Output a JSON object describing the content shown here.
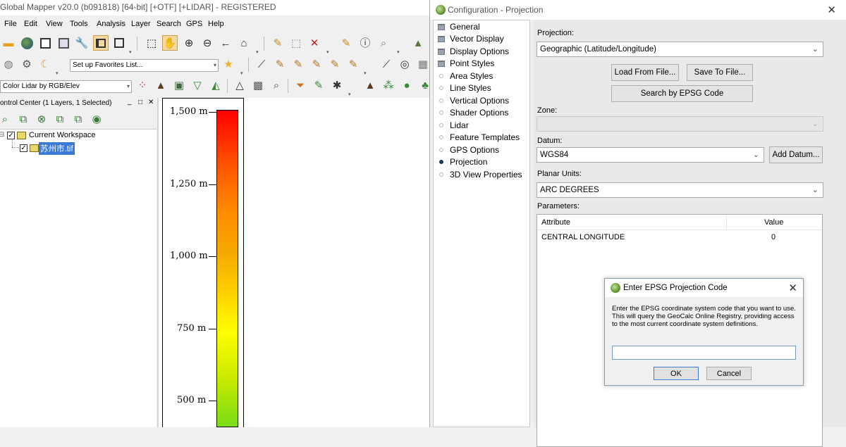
{
  "app": {
    "title": "Global Mapper v20.0 (b091818) [64-bit] [+OTF] [+LIDAR] - REGISTERED",
    "menu": [
      "File",
      "Edit",
      "View",
      "Tools",
      "Analysis",
      "Layer",
      "Search",
      "GPS",
      "Help"
    ],
    "favorites_combo": "Set up Favorites List...",
    "lidar_combo": "Color Lidar by RGB/Elev"
  },
  "control_center": {
    "header": "ontrol Center (1 Layers, 1 Selected)",
    "header_buttons": [
      "_",
      "□",
      "✕"
    ],
    "workspace_label": "Current Workspace",
    "layer_label": "苏州市.tif"
  },
  "legend": {
    "labels": [
      "1,500 m",
      "1,250 m",
      "1,000 m",
      "750 m",
      "500 m"
    ],
    "colors": {
      "top": "#ff0000",
      "mid": "#ffff00",
      "bottom": "#79dc18"
    }
  },
  "config": {
    "title": "Configuration - Projection",
    "nav": [
      {
        "label": "General",
        "kind": "folder"
      },
      {
        "label": "Vector Display",
        "kind": "folder"
      },
      {
        "label": "Display Options",
        "kind": "folder"
      },
      {
        "label": "Point Styles",
        "kind": "folder"
      },
      {
        "label": "Area Styles",
        "kind": "dot"
      },
      {
        "label": "Line Styles",
        "kind": "dot"
      },
      {
        "label": "Vertical Options",
        "kind": "dot"
      },
      {
        "label": "Shader Options",
        "kind": "dot"
      },
      {
        "label": "Lidar",
        "kind": "dot"
      },
      {
        "label": "Feature Templates",
        "kind": "dot"
      },
      {
        "label": "GPS Options",
        "kind": "dot"
      },
      {
        "label": "Projection",
        "kind": "selected"
      },
      {
        "label": "3D View Properties",
        "kind": "dot"
      }
    ],
    "projection_label": "Projection:",
    "projection_value": "Geographic (Latitude/Longitude)",
    "load_button": "Load From File...",
    "save_button": "Save To File...",
    "epsg_button": "Search by EPSG Code",
    "zone_label": "Zone:",
    "zone_value": "",
    "datum_label": "Datum:",
    "datum_value": "WGS84",
    "add_datum_button": "Add Datum...",
    "units_label": "Planar Units:",
    "units_value": "ARC DEGREES",
    "params_label": "Parameters:",
    "params_columns": [
      "Attribute",
      "Value"
    ],
    "params_rows": [
      {
        "attribute": "CENTRAL LONGITUDE",
        "value": "0"
      }
    ]
  },
  "epsg_dialog": {
    "title": "Enter EPSG Projection Code",
    "description": "Enter the EPSG coordinate system code that you want to use. This will query the GeoCalc Online Registry, providing access to the most current coordinate system definitions.",
    "input_value": "",
    "ok": "OK",
    "cancel": "Cancel"
  }
}
